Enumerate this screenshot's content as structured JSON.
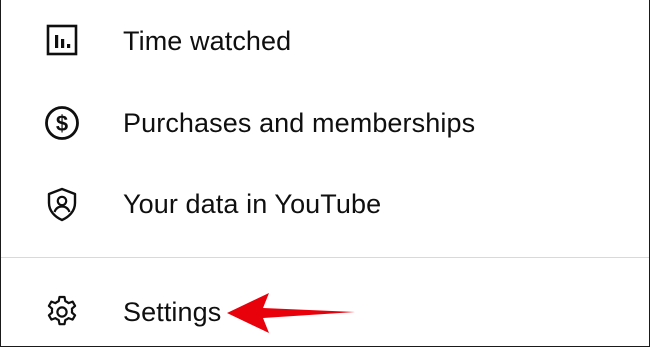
{
  "menu": {
    "items": [
      {
        "label": "Time watched",
        "icon": "bar-chart-icon"
      },
      {
        "label": "Purchases and memberships",
        "icon": "dollar-circle-icon"
      },
      {
        "label": "Your data in YouTube",
        "icon": "user-shield-icon"
      }
    ],
    "settings": {
      "label": "Settings",
      "icon": "gear-icon"
    }
  },
  "annotation": {
    "type": "arrow",
    "color": "#e8000b",
    "points_to": "Settings"
  }
}
